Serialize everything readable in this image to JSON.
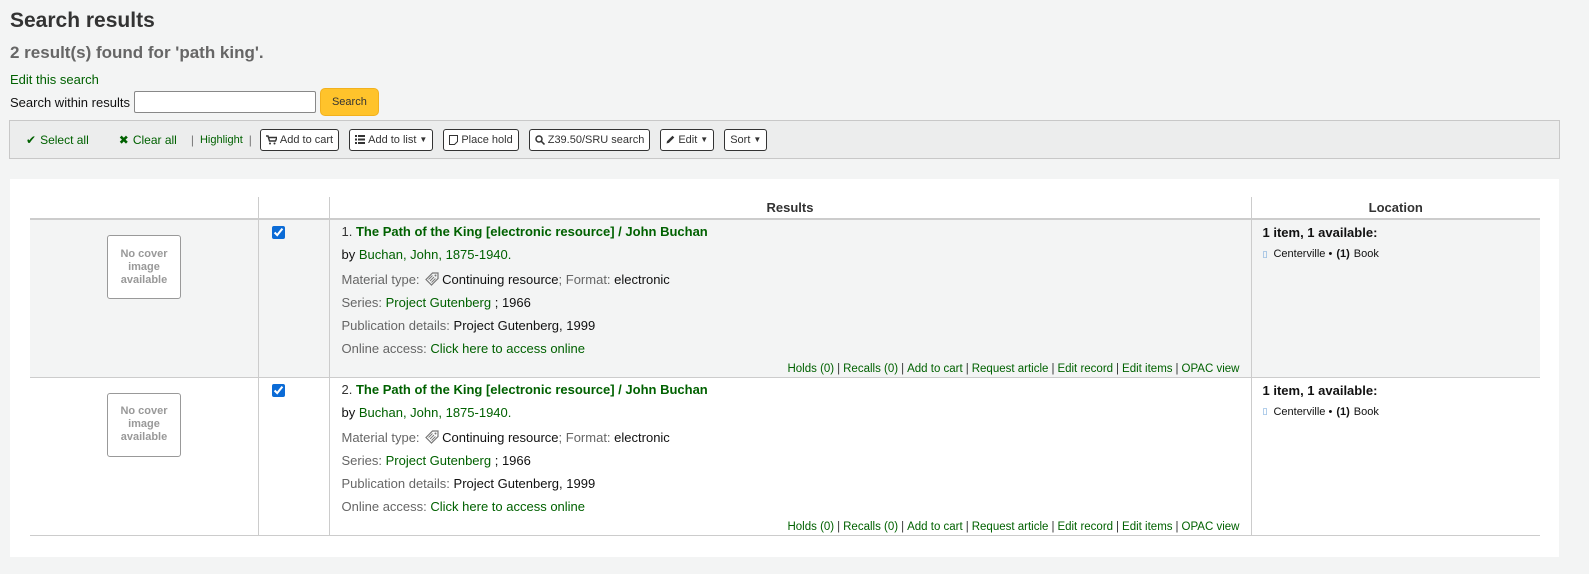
{
  "header": {
    "title": "Search results",
    "count_text": "2 result(s) found for 'path king'.",
    "edit_search": "Edit this search"
  },
  "search_within": {
    "label": "Search within results",
    "value": "",
    "button": "Search"
  },
  "toolbar": {
    "select_all": "Select all",
    "clear_all": "Clear all",
    "highlight": "Highlight",
    "add_to_cart": "Add to cart",
    "add_to_list": "Add to list",
    "place_hold": "Place hold",
    "z3950": "Z39.50/SRU search",
    "edit": "Edit",
    "sort": "Sort"
  },
  "table": {
    "headers": [
      "",
      "",
      "Results",
      "Location"
    ]
  },
  "records": [
    {
      "cover_text": "No cover image available",
      "checked": true,
      "number": "1.",
      "title": "The Path of the King [electronic resource] / John Buchan",
      "by": "by",
      "author": "Buchan, John, 1875-1940.",
      "material_label": "Material type:",
      "material_value": "Continuing resource",
      "format_label": "; Format:",
      "format_value": "electronic",
      "series_label": "Series:",
      "series_link": "Project Gutenberg",
      "series_rest": " ; 1966",
      "publication_label": "Publication details:",
      "publication_value": "Project Gutenberg, 1999",
      "online_label": "Online access:",
      "online_link": "Click here to access online",
      "actions": [
        "Holds (0)",
        "Recalls (0)",
        "Add to cart",
        "Request article",
        "Edit record",
        "Edit items",
        "OPAC view"
      ],
      "availability": "1 item, 1 available:",
      "library": "Centerville •",
      "copies": "(1)",
      "item_type": "Book"
    },
    {
      "cover_text": "No cover image available",
      "checked": true,
      "number": "2.",
      "title": "The Path of the King [electronic resource] / John Buchan",
      "by": "by",
      "author": "Buchan, John, 1875-1940.",
      "material_label": "Material type:",
      "material_value": "Continuing resource",
      "format_label": "; Format:",
      "format_value": "electronic",
      "series_label": "Series:",
      "series_link": "Project Gutenberg",
      "series_rest": " ; 1966",
      "publication_label": "Publication details:",
      "publication_value": "Project Gutenberg, 1999",
      "online_label": "Online access:",
      "online_link": "Click here to access online",
      "actions": [
        "Holds (0)",
        "Recalls (0)",
        "Add to cart",
        "Request article",
        "Edit record",
        "Edit items",
        "OPAC view"
      ],
      "availability": "1 item, 1 available:",
      "library": "Centerville •",
      "copies": "(1)",
      "item_type": "Book"
    }
  ]
}
